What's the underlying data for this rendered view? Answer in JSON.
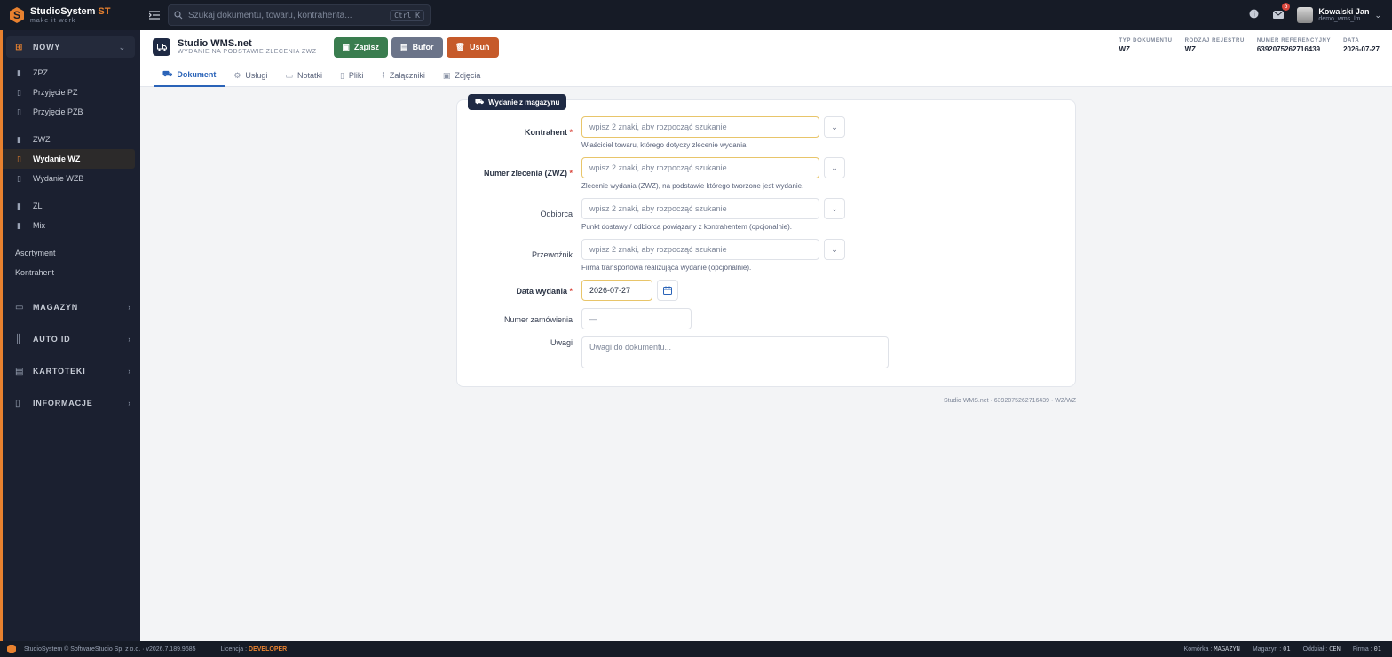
{
  "app": {
    "name": "StudioSystem",
    "name_suffix": "ST",
    "tagline": "make it work"
  },
  "search": {
    "placeholder": "Szukaj dokumentu, towaru, kontrahenta...",
    "shortcut": "Ctrl K"
  },
  "notifications": {
    "count": "5"
  },
  "user": {
    "name": "Kowalski Jan",
    "login": "demo_wms_lm"
  },
  "sidebar": {
    "new_label": "NOWY",
    "group1": [
      {
        "label": "ZPZ"
      },
      {
        "label": "Przyjęcie PZ"
      },
      {
        "label": "Przyjęcie PZB"
      }
    ],
    "group2": [
      {
        "label": "ZWZ"
      },
      {
        "label": "Wydanie WZ"
      },
      {
        "label": "Wydanie WZB"
      }
    ],
    "group3": [
      {
        "label": "ZL"
      },
      {
        "label": "Mix"
      }
    ],
    "plain": [
      {
        "label": "Asortyment"
      },
      {
        "label": "Kontrahent"
      }
    ],
    "sections": [
      {
        "label": "MAGAZYN"
      },
      {
        "label": "AUTO ID"
      },
      {
        "label": "KARTOTEKI"
      },
      {
        "label": "INFORMACJE"
      }
    ]
  },
  "header": {
    "title": "Studio WMS.net",
    "subtitle": "WYDANIE NA PODSTAWIE ZLECENIA ZWZ",
    "buttons": {
      "save": "Zapisz",
      "buffer": "Bufor",
      "delete": "Usuń"
    },
    "meta": [
      {
        "key": "TYP DOKUMENTU",
        "value": "WZ"
      },
      {
        "key": "RODZAJ REJESTRU",
        "value": "WZ"
      },
      {
        "key": "NUMER REFERENCYJNY",
        "value": "6392075262716439"
      },
      {
        "key": "DATA",
        "value": "2026-07-27"
      }
    ]
  },
  "tabs": [
    {
      "label": "Dokument"
    },
    {
      "label": "Usługi"
    },
    {
      "label": "Notatki"
    },
    {
      "label": "Pliki"
    },
    {
      "label": "Załączniki"
    },
    {
      "label": "Zdjęcia"
    }
  ],
  "form": {
    "tag": "Wydanie z magazynu",
    "kontrahent": {
      "label": "Kontrahent",
      "placeholder": "wpisz 2 znaki, aby rozpocząć szukanie",
      "hint": "Właściciel towaru, którego dotyczy zlecenie wydania."
    },
    "zlecenie": {
      "label": "Numer zlecenia (ZWZ)",
      "placeholder": "wpisz 2 znaki, aby rozpocząć szukanie",
      "hint": "Zlecenie wydania (ZWZ), na podstawie którego tworzone jest wydanie."
    },
    "odbiorca": {
      "label": "Odbiorca",
      "placeholder": "wpisz 2 znaki, aby rozpocząć szukanie",
      "hint": "Punkt dostawy / odbiorca powiązany z kontrahentem (opcjonalnie)."
    },
    "przewoznik": {
      "label": "Przewoźnik",
      "placeholder": "wpisz 2 znaki, aby rozpocząć szukanie",
      "hint": "Firma transportowa realizująca wydanie (opcjonalnie)."
    },
    "data": {
      "label": "Data wydania",
      "value": "2026-07-27"
    },
    "zamowienie": {
      "label": "Numer zamówienia",
      "placeholder": "—"
    },
    "uwagi": {
      "label": "Uwagi",
      "placeholder": "Uwagi do dokumentu..."
    },
    "required_mark": "*"
  },
  "footer_note": "Studio WMS.net · 6392075262716439 · WZ/WZ",
  "status": {
    "copyright": "StudioSystem © SoftwareStudio Sp. z o.o. · v2026.7.189.9685",
    "license_label": "Licencja :",
    "license_value": "DEVELOPER",
    "items": [
      {
        "label": "Komórka :",
        "value": "MAGAZYN"
      },
      {
        "label": "Magazyn :",
        "value": "01"
      },
      {
        "label": "Oddział :",
        "value": "CEN"
      },
      {
        "label": "Firma :",
        "value": "01"
      }
    ]
  },
  "colors": {
    "accent": "#e8812f",
    "primary": "#2a63b8",
    "save": "#3a7d4f",
    "buffer": "#6b7489",
    "delete": "#c65a2a"
  }
}
